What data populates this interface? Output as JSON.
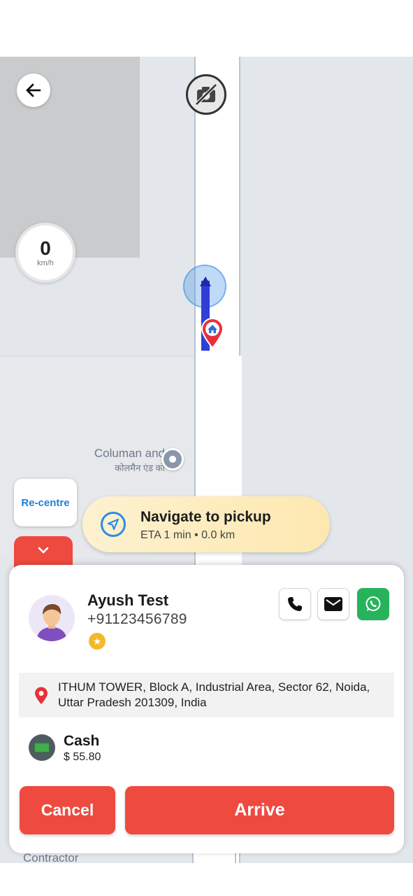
{
  "map": {
    "poi_name_en": "Columan and",
    "poi_name_hi": "कोलमैन एंड को",
    "bottom_label": "Contractor",
    "speed_value": "0",
    "speed_unit": "km/h",
    "recentre_label": "Re-centre"
  },
  "navigation": {
    "title": "Navigate to pickup",
    "eta": "ETA 1 min",
    "separator": "•",
    "distance": "0.0 km"
  },
  "rider": {
    "name": "Ayush Test",
    "phone": "+91123456789",
    "rating_icon": "star-icon"
  },
  "contact": {
    "call_icon": "phone-icon",
    "message_icon": "mail-icon",
    "whatsapp_icon": "whatsapp-icon"
  },
  "pickup": {
    "address": "ITHUM TOWER, Block A, Industrial Area, Sector 62, Noida, Uttar Pradesh 201309, India"
  },
  "payment": {
    "method": "Cash",
    "amount": "$ 55.80"
  },
  "actions": {
    "cancel_label": "Cancel",
    "arrive_label": "Arrive"
  },
  "colors": {
    "primary_red": "#ef4a40",
    "accent_blue": "#1f7fd8",
    "route_blue": "#2f3fd4",
    "whatsapp_green": "#27b35b",
    "nav_pill_yellow": "#fde8b0"
  }
}
